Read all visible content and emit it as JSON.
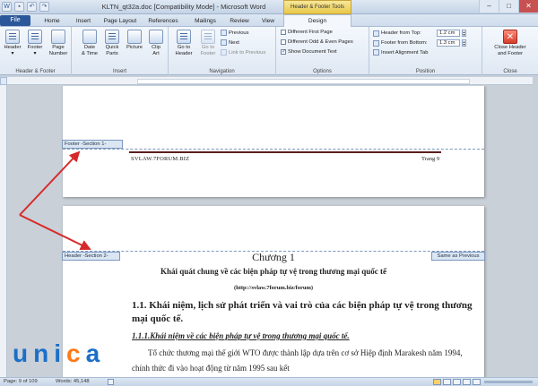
{
  "window": {
    "title": "KLTN_qt32a.doc [Compatibility Mode] - Microsoft Word",
    "contextual_tab_group": "Header & Footer Tools"
  },
  "tabs": [
    "File",
    "Home",
    "Insert",
    "Page Layout",
    "References",
    "Mailings",
    "Review",
    "View",
    "Design"
  ],
  "ribbon": {
    "header_footer": {
      "label": "Header & Footer",
      "header": "Header",
      "footer": "Footer",
      "page_number_l1": "Page",
      "page_number_l2": "Number"
    },
    "insert": {
      "label": "Insert",
      "date_time_l1": "Date",
      "date_time_l2": "& Time",
      "quick_parts_l1": "Quick",
      "quick_parts_l2": "Parts",
      "picture": "Picture",
      "clip_art_l1": "Clip",
      "clip_art_l2": "Art"
    },
    "navigation": {
      "label": "Navigation",
      "goto_header_l1": "Go to",
      "goto_header_l2": "Header",
      "goto_footer_l1": "Go to",
      "goto_footer_l2": "Footer",
      "previous": "Previous",
      "next": "Next",
      "link_to_previous": "Link to Previous"
    },
    "options": {
      "label": "Options",
      "different_first_page": "Different First Page",
      "different_odd_even": "Different Odd & Even Pages",
      "show_document_text": "Show Document Text"
    },
    "position": {
      "label": "Position",
      "header_from_top": "Header from Top:",
      "header_from_top_value": "1.2 cm",
      "footer_from_bottom": "Footer from Bottom:",
      "footer_from_bottom_value": "1.3 cm",
      "insert_alignment_tab": "Insert Alignment Tab"
    },
    "close": {
      "label": "Close",
      "close_l1": "Close Header",
      "close_l2": "and Footer"
    }
  },
  "document": {
    "footer_tag": "Footer -Section 1-",
    "footer_left": "SVLAW.7FORUM.BIZ",
    "footer_right": "Trang 9",
    "header_tag": "Header -Section 2-",
    "same_as_previous": "Same as Previous",
    "chapter": "Chương 1",
    "title": "Khái quát chung về các biện pháp tự vệ trong thương mại quốc tế",
    "url": "(http://svlaw.7forum.biz/forum)",
    "section_heading": "1.1. Khái niệm, lịch sử phát triển và vai trò của các biện pháp tự vệ trong thương mại quốc tế.",
    "subsection_heading": "1.1.1.Khái niệm về các biện pháp tự vệ trong thương mại quốc tế.",
    "paragraph": "Tổ chức thương mại thế giới WTO được thành lập dựa trên cơ sở Hiệp định Marakesh năm 1994, chính thức đi vào hoạt động từ năm 1995 sau kết"
  },
  "status": {
    "page": "Page: 9 of 109",
    "words": "Words: 45,148"
  },
  "watermark": {
    "logo_text": "unica"
  },
  "colors": {
    "file_tab": "#2b579a",
    "contextual_tab": "#f0d36a",
    "annotation_arrow": "#d62a2a",
    "logo_blue": "#1a6fc7",
    "logo_orange": "#ff7a1a"
  }
}
